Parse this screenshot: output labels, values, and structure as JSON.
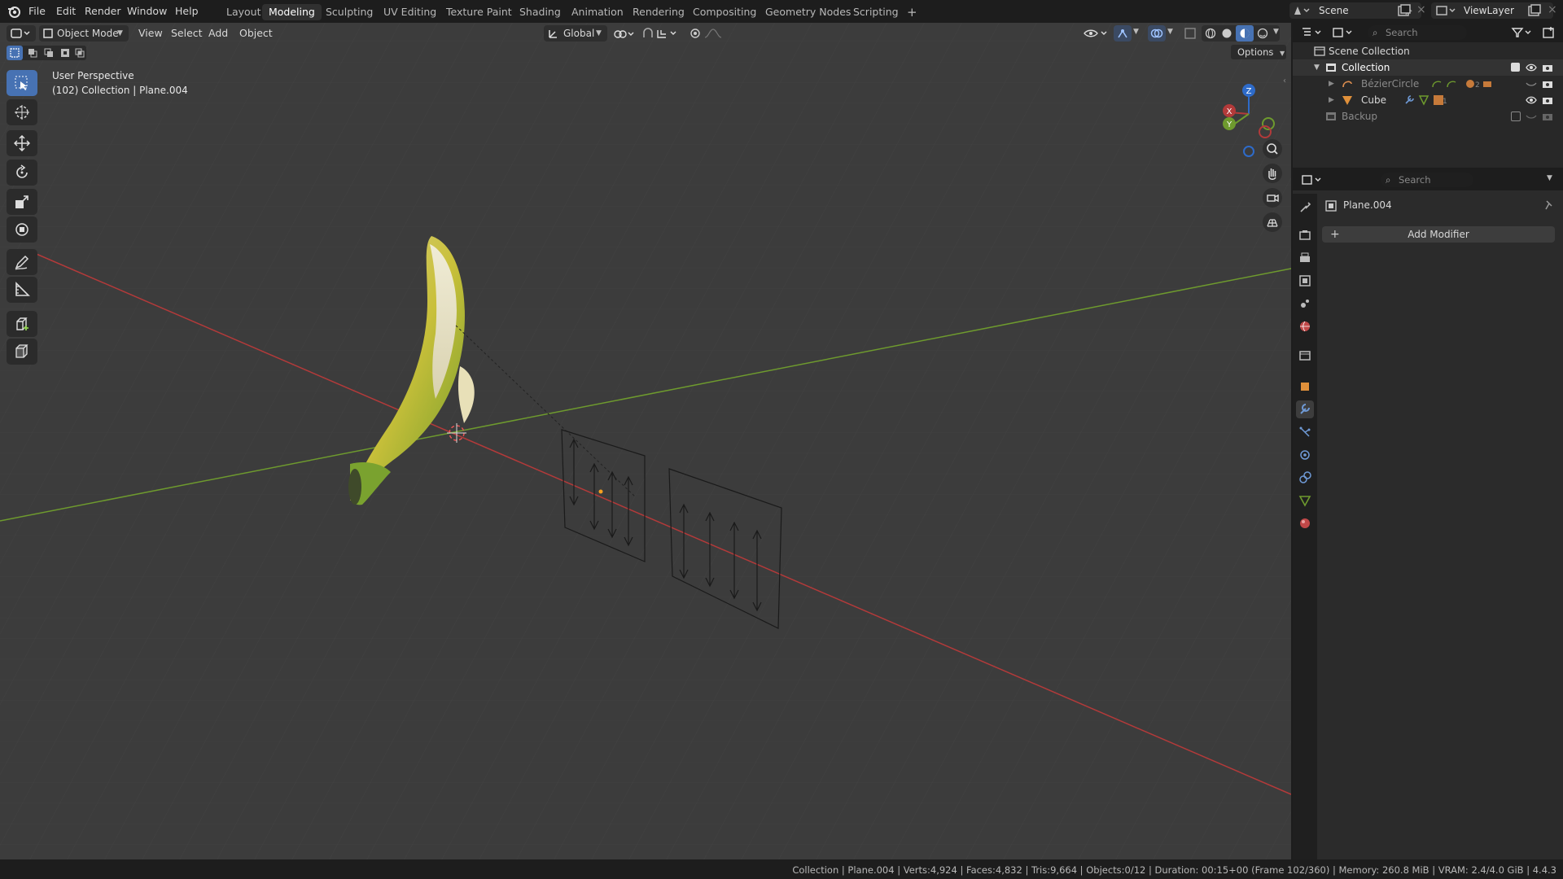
{
  "topbar": {
    "menus": [
      "File",
      "Edit",
      "Render",
      "Window",
      "Help"
    ],
    "workspaces": [
      "Layout",
      "Modeling",
      "Sculpting",
      "UV Editing",
      "Texture Paint",
      "Shading",
      "Animation",
      "Rendering",
      "Compositing",
      "Geometry Nodes",
      "Scripting"
    ],
    "active_workspace": "Modeling",
    "add_workspace": "+",
    "scene": "Scene",
    "view_layer": "ViewLayer"
  },
  "viewport_header": {
    "mode": "Object Mode",
    "menus": [
      "View",
      "Select",
      "Add",
      "Object"
    ],
    "transform_orientation": "Global",
    "options": "Options"
  },
  "viewport": {
    "perspective": "User Perspective",
    "context": "(102) Collection | Plane.004",
    "gizmo": {
      "x": "X",
      "y": "Y",
      "z": "Z"
    }
  },
  "outliner": {
    "search_placeholder": "Search",
    "scene_collection": "Scene Collection",
    "collection": "Collection",
    "items": [
      {
        "name": "BézierCircle",
        "badge": "2"
      },
      {
        "name": "Cube",
        "badge": "1"
      }
    ],
    "backup": "Backup"
  },
  "properties": {
    "search_placeholder": "Search",
    "object_name": "Plane.004",
    "add_modifier": "Add Modifier"
  },
  "statusbar": {
    "text": "Collection | Plane.004 | Verts:4,924 | Faces:4,832 | Tris:9,664 | Objects:0/12 | Duration: 00:15+00 (Frame 102/360) | Memory: 260.8 MiB | VRAM: 2.4/4.0 GiB | 4.4.3"
  },
  "colors": {
    "accent": "#4772b3",
    "x_axis": "#b33a3a",
    "y_axis": "#6e9a2e",
    "z_axis": "#2e6bc9",
    "viewport_bg": "#3c3c3c"
  }
}
